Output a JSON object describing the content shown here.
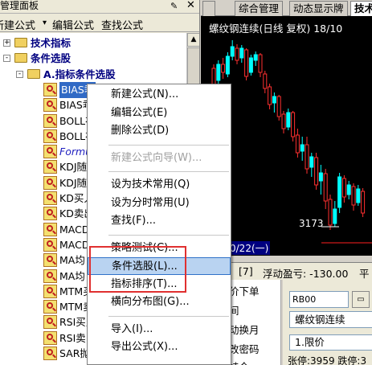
{
  "left_panel": {
    "title": "管理面板",
    "toolbar": [
      "新建公式",
      "编辑公式",
      "查找公式"
    ],
    "tree": [
      {
        "label": "技术指标",
        "level": 0,
        "kind": "folder",
        "expander": "+"
      },
      {
        "label": "条件选股",
        "level": 0,
        "kind": "folder",
        "expander": "-"
      },
      {
        "label": "A.指标条件选股",
        "level": 1,
        "kind": "folder",
        "expander": "-"
      },
      {
        "label": "BIAS乖",
        "level": 2,
        "kind": "formula",
        "selected": true
      },
      {
        "label": "BIAS乖",
        "level": 2,
        "kind": "formula"
      },
      {
        "label": "BOLL布",
        "level": 2,
        "kind": "formula"
      },
      {
        "label": "BOLL布",
        "level": 2,
        "kind": "formula"
      },
      {
        "label": "Formu",
        "level": 2,
        "kind": "formula",
        "blue": true
      },
      {
        "label": "KDJ随",
        "level": 2,
        "kind": "formula"
      },
      {
        "label": "KDJ随",
        "level": 2,
        "kind": "formula"
      },
      {
        "label": "KD买入",
        "level": 2,
        "kind": "formula"
      },
      {
        "label": "KD卖出",
        "level": 2,
        "kind": "formula"
      },
      {
        "label": "MACD",
        "level": 2,
        "kind": "formula"
      },
      {
        "label": "MACD",
        "level": 2,
        "kind": "formula"
      },
      {
        "label": "MA均",
        "level": 2,
        "kind": "formula"
      },
      {
        "label": "MA均",
        "level": 2,
        "kind": "formula"
      },
      {
        "label": "MTM买",
        "level": 2,
        "kind": "formula"
      },
      {
        "label": "MTM卖",
        "level": 2,
        "kind": "formula"
      },
      {
        "label": "RSI买入",
        "level": 2,
        "kind": "formula"
      },
      {
        "label": "RSI卖出",
        "level": 2,
        "kind": "formula"
      },
      {
        "label": "SAR抛",
        "level": 2,
        "kind": "formula"
      }
    ]
  },
  "tabs": [
    "综合管理",
    "动态显示牌",
    "技术"
  ],
  "chart": {
    "title": "螺纹钢连续(日线 复权) 18/10",
    "date_label": "0/22(一)",
    "low_price": "3173",
    "colors": {
      "up": "#ff3030",
      "down": "#00ffff",
      "bg": "#000000"
    }
  },
  "bottom_status": {
    "left": "[7]",
    "pnl": "浮动盈亏: -130.00",
    "right": "平"
  },
  "trade_panel": {
    "left_items": [
      "价下单",
      "间",
      "动换月",
      "改密码",
      "持仓"
    ],
    "code": "RB00",
    "name": "螺纹钢连续",
    "order_type": "1.限价",
    "limits": "张停:3959 跌停:3"
  },
  "context_menu": {
    "items": [
      {
        "label": "新建公式(N)...",
        "disabled": false
      },
      {
        "label": "编辑公式(E)",
        "disabled": false
      },
      {
        "label": "删除公式(D)",
        "disabled": false
      },
      {
        "sep": true
      },
      {
        "label": "新建公式向导(W)...",
        "disabled": true
      },
      {
        "sep": true
      },
      {
        "label": "设为技术常用(Q)",
        "disabled": false
      },
      {
        "label": "设为分时常用(U)",
        "disabled": false
      },
      {
        "label": "查找(F)...",
        "disabled": false
      },
      {
        "sep": true
      },
      {
        "label": "策略测试(C)...",
        "disabled": false
      },
      {
        "label": "条件选股(L)...",
        "disabled": false,
        "highlight": true
      },
      {
        "label": "指标排序(T)...",
        "disabled": false
      },
      {
        "label": "横向分布图(G)...",
        "disabled": false
      },
      {
        "sep": true
      },
      {
        "label": "导入(I)...",
        "disabled": false
      },
      {
        "label": "导出公式(X)...",
        "disabled": false
      }
    ]
  }
}
